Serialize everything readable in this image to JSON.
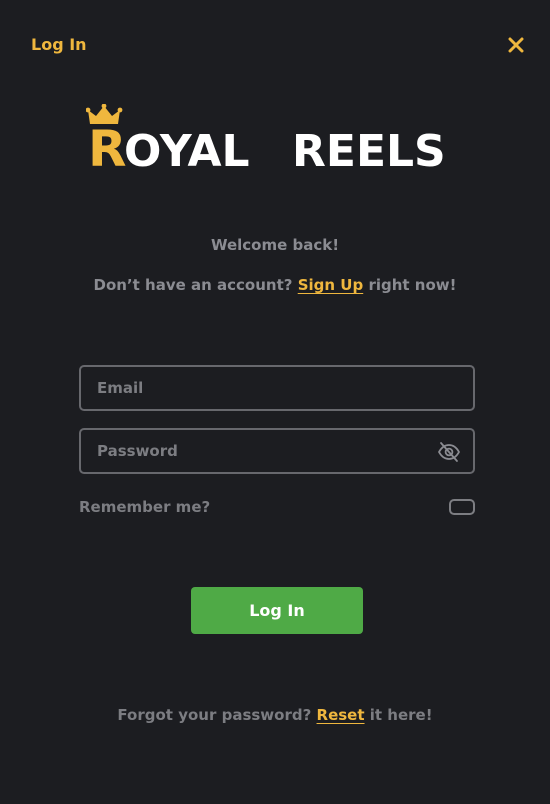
{
  "header": {
    "title": "Log In",
    "close_icon": "close-icon"
  },
  "logo": {
    "first_letter": "R",
    "word1_rest": "OYAL",
    "word2": "REELS",
    "crown_icon": "crown-icon"
  },
  "welcome_text": "Welcome back!",
  "signup": {
    "prefix": "Don’t have an account?",
    "link": "Sign Up",
    "suffix": "right now!"
  },
  "form": {
    "email_placeholder": "Email",
    "email_value": "",
    "password_placeholder": "Password",
    "password_value": "",
    "password_toggle_icon": "eye-off-icon",
    "remember_label": "Remember me?",
    "remember_checked": false,
    "submit_label": "Log In"
  },
  "forgot": {
    "prefix": "Forgot your password?",
    "link": "Reset",
    "suffix": "it here!"
  },
  "colors": {
    "background": "#1c1d21",
    "accent": "#efb73e",
    "button": "#4faa46",
    "muted_text": "#8b8c92",
    "border": "#67686d"
  }
}
